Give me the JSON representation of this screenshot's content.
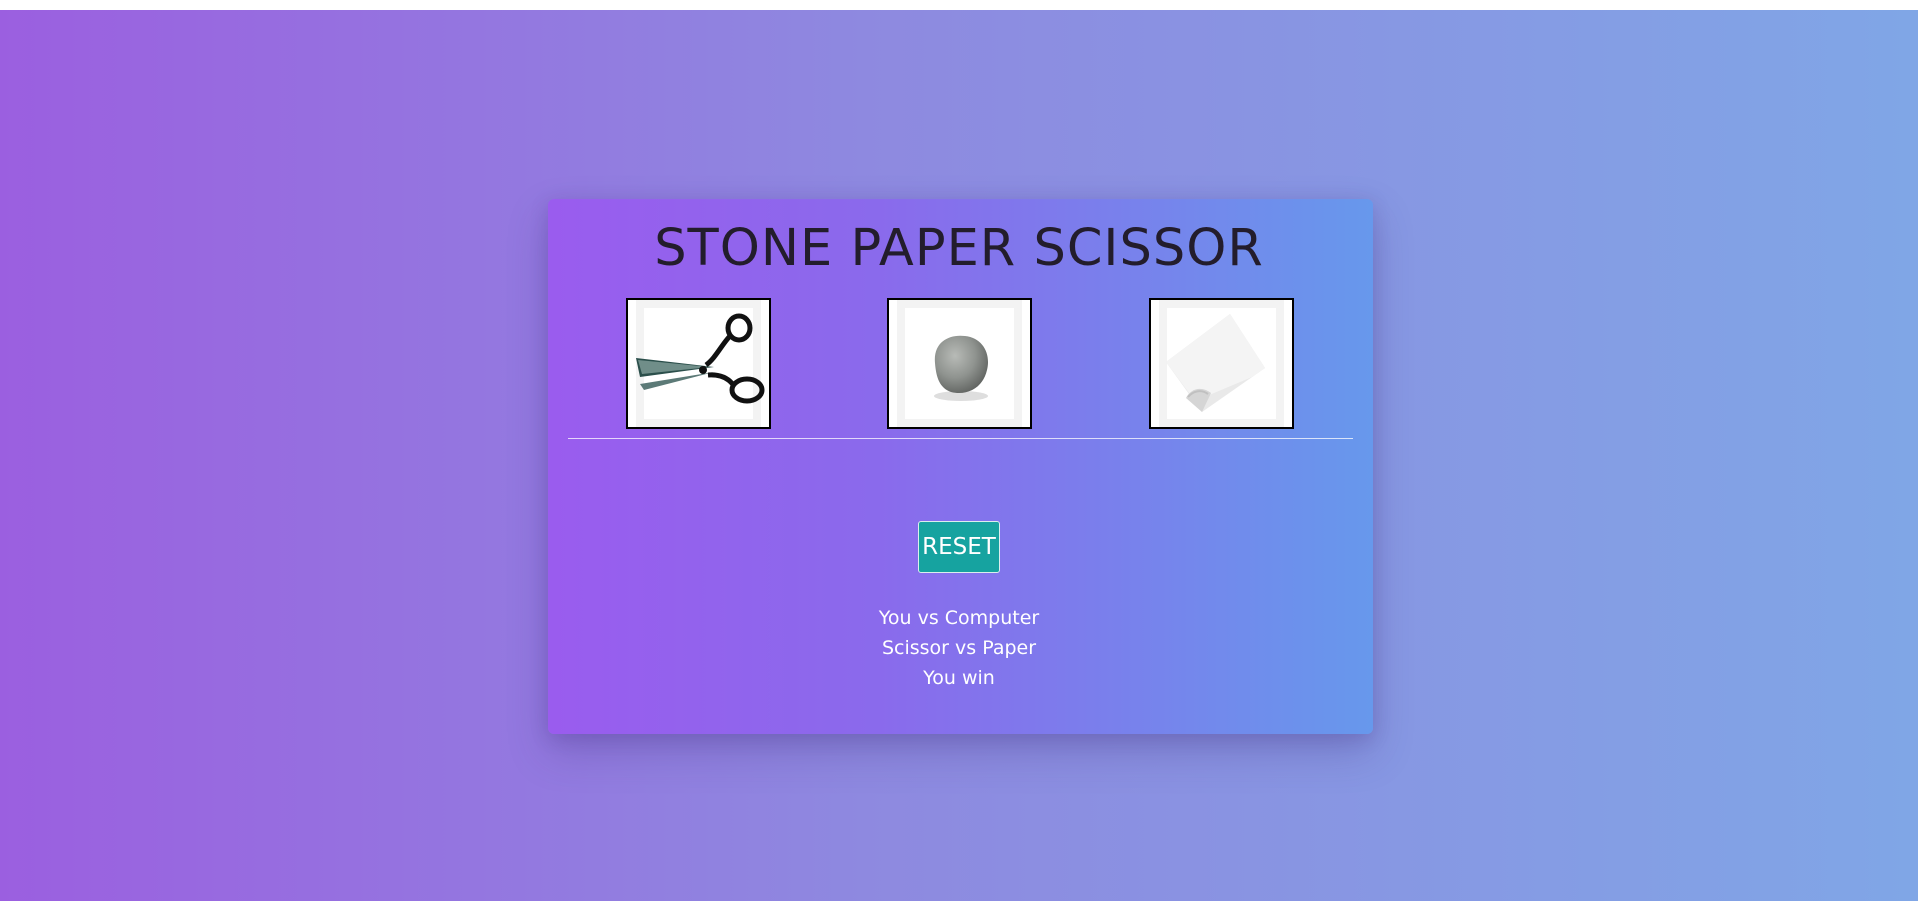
{
  "title": "STONE PAPER SCISSOR",
  "choices": [
    {
      "label": "Scissor",
      "icon": "scissors-icon"
    },
    {
      "label": "Stone",
      "icon": "stone-icon"
    },
    {
      "label": "Paper",
      "icon": "paper-icon"
    }
  ],
  "reset_label": "RESET",
  "result": {
    "line1": "You vs Computer",
    "line2": "Scissor vs Paper",
    "line3": "You win"
  },
  "colors": {
    "background_start": "#9b5fe0",
    "background_end": "#80a6e6",
    "card_start": "#9a5cee",
    "card_end": "#6798ec",
    "reset_button": "#16a3a0",
    "title": "#231d2c"
  }
}
